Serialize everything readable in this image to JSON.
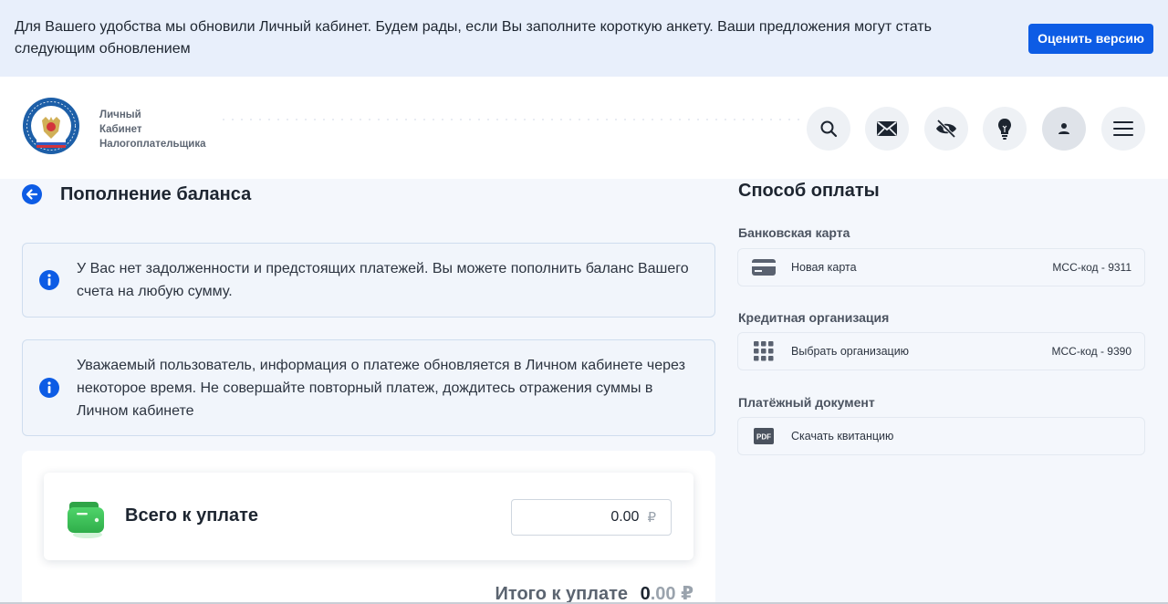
{
  "banner": {
    "text": "Для Вашего удобства мы обновили Личный кабинет. Будем рады, если Вы заполните короткую анкету. Ваши предложения могут стать следующим обновлением",
    "button_label": "Оценить версию"
  },
  "header": {
    "logo_lines": [
      "Личный",
      "Кабинет",
      "Налогоплательщика"
    ],
    "icons": [
      "search-icon",
      "mail-icon",
      "eye-off-icon",
      "lightbulb-icon",
      "user-icon",
      "menu-icon"
    ]
  },
  "page": {
    "title": "Пополнение баланса",
    "info1": "У Вас нет задолженности и предстоящих платежей. Вы можете пополнить баланс Вашего счета на любую сумму.",
    "info2": "Уважаемый пользователь, информация о платеже обновляется в Личном кабинете через некоторое время. Не совершайте повторный платеж, дождитесь отражения суммы в Личном кабинете"
  },
  "payment": {
    "label": "Всего к уплате",
    "amount": "0.00",
    "currency": "₽",
    "total_label": "Итого к уплате",
    "total_int": "0",
    "total_dec": ".00",
    "total_currency": "₽"
  },
  "right": {
    "title": "Способ оплаты",
    "sections": [
      {
        "label": "Банковская карта",
        "option": "Новая карта",
        "mcc": "МСС-код - 9311"
      },
      {
        "label": "Кредитная организация",
        "option": "Выбрать организацию",
        "mcc": "МСС-код - 9390"
      },
      {
        "label": "Платёжный документ",
        "option": "Скачать квитанцию",
        "mcc": ""
      }
    ],
    "pdf_badge": "PDF"
  },
  "colors": {
    "accent": "#0d5ce5",
    "banner_bg": "#e8effb",
    "wallet_green": "#3ec95a"
  }
}
